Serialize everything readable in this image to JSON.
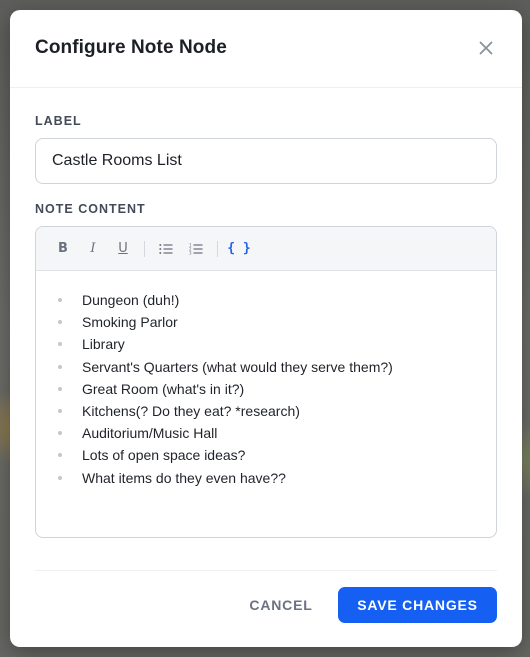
{
  "modal": {
    "title": "Configure Note Node",
    "close_icon": "close-icon"
  },
  "label_field": {
    "label": "LABEL",
    "value": "Castle Rooms List"
  },
  "content_field": {
    "label": "NOTE CONTENT",
    "toolbar": {
      "bold": "B",
      "italic": "I",
      "underline": "U",
      "bullet_list_icon": "bullet-list-icon",
      "ordered_list_icon": "ordered-list-icon",
      "code": "{ }"
    },
    "items": [
      "Dungeon (duh!)",
      "Smoking Parlor",
      "Library",
      "Servant's Quarters (what would they serve them?)",
      "Great Room (what's in it?)",
      "Kitchens(? Do they eat? *research)",
      "Auditorium/Music Hall",
      "Lots of open space ideas?",
      "What items do they even have??"
    ]
  },
  "footer": {
    "cancel_label": "CANCEL",
    "save_label": "SAVE CHANGES"
  },
  "colors": {
    "accent": "#1560f2",
    "code_button": "#2563eb"
  }
}
